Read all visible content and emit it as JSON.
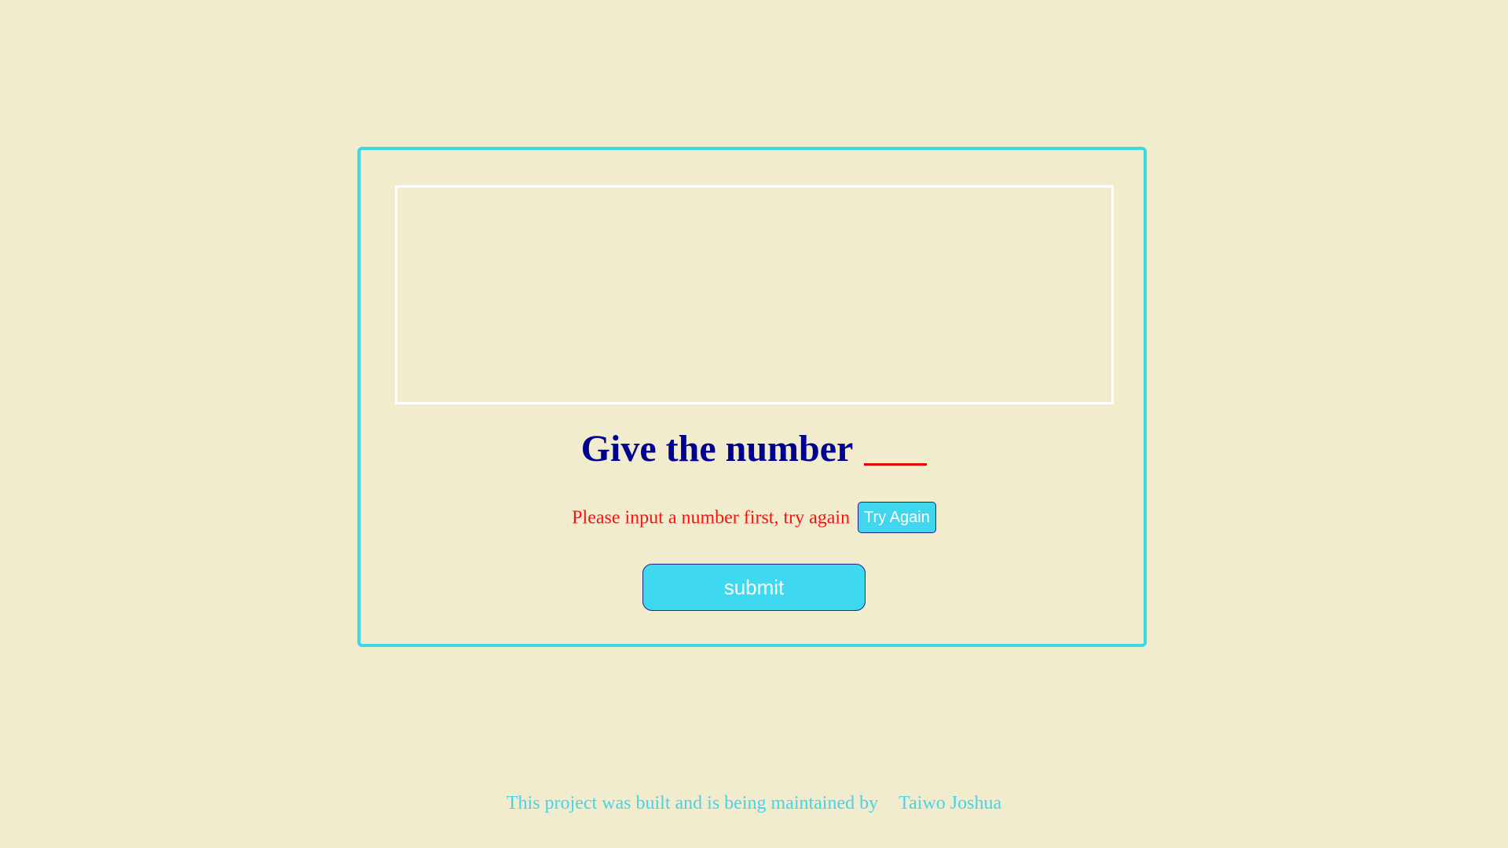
{
  "game": {
    "display_text": "",
    "heading": "Give the number",
    "error_message": "Please input a number first, try again",
    "try_again_label": "Try Again",
    "submit_label": "submit"
  },
  "footer": {
    "text": "This project was built and is being maintained by",
    "author": "Taiwo Joshua"
  },
  "colors": {
    "background": "#f2eccf",
    "accent": "#3fd6e6",
    "heading": "#000090",
    "error": "#ff1010",
    "button_border": "#1a237e"
  }
}
